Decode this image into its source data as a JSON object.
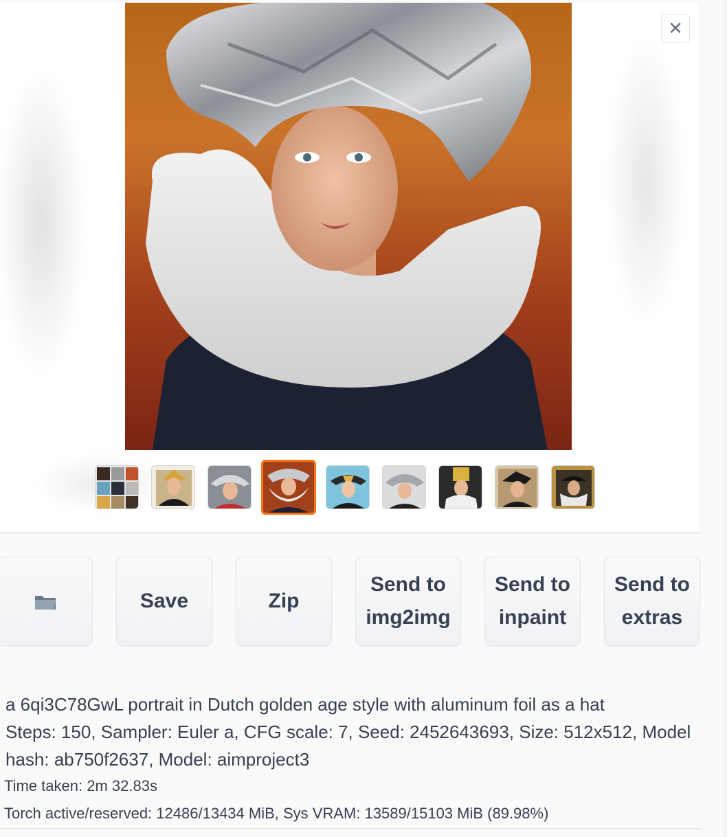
{
  "gallery": {
    "close_icon": "close-icon",
    "main_image_alt": "portrait-with-foil-hat",
    "selected_index": 3,
    "thumbnails": [
      {
        "name": "thumb-grid"
      },
      {
        "name": "thumb-2"
      },
      {
        "name": "thumb-3"
      },
      {
        "name": "thumb-4"
      },
      {
        "name": "thumb-5"
      },
      {
        "name": "thumb-6"
      },
      {
        "name": "thumb-7"
      },
      {
        "name": "thumb-8"
      },
      {
        "name": "thumb-9"
      }
    ]
  },
  "actions": {
    "folder_icon": "folder-icon",
    "save_label": "Save",
    "zip_label": "Zip",
    "send_img2img_line1": "Send to",
    "send_img2img_line2": "img2img",
    "send_inpaint_line1": "Send to",
    "send_inpaint_line2": "inpaint",
    "send_extras_line1": "Send to",
    "send_extras_line2": "extras"
  },
  "info": {
    "prompt": "a 6qi3C78GwL portrait in Dutch golden age style with aluminum foil as a hat",
    "params": "Steps: 150, Sampler: Euler a, CFG scale: 7, Seed: 2452643693, Size: 512x512, Model hash: ab750f2637, Model: aimproject3",
    "time_taken": "Time taken: 2m 32.83s",
    "vram": "Torch active/reserved: 12486/13434 MiB, Sys VRAM: 13589/15103 MiB (89.98%)"
  },
  "colors": {
    "accent": "#f97316",
    "button_bg": "#f3f4f6",
    "text": "#374151"
  }
}
